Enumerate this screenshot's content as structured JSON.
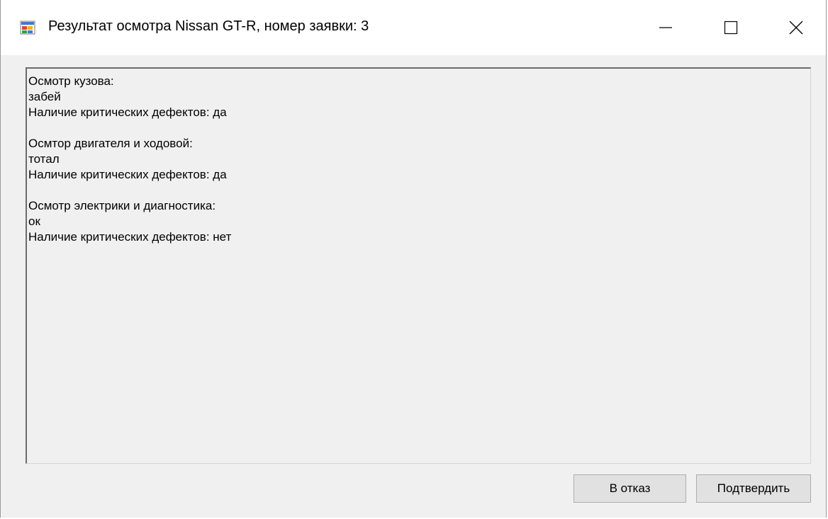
{
  "window": {
    "title": "Результат осмотра Nissan GT-R, номер заявки: 3",
    "icon": "winforms-app-icon",
    "controls": {
      "minimize_icon": "minimize-icon",
      "maximize_icon": "maximize-icon",
      "close_icon": "close-icon"
    }
  },
  "report": {
    "lines": [
      "Осмотр кузова:",
      "забей",
      "Наличие критических дефектов: да",
      "",
      "Осмтор двигателя и ходовой:",
      "тотал",
      "Наличие критических дефектов: да",
      "",
      "Осмотр электрики и диагностика:",
      "ок",
      "Наличие критических дефектов: нет"
    ]
  },
  "buttons": {
    "reject_label": "В отказ",
    "confirm_label": "Подтвердить"
  },
  "colors": {
    "form_background": "#f0f0f0",
    "titlebar_background": "#ffffff",
    "button_background": "#e1e1e1",
    "button_border": "#adadad"
  }
}
